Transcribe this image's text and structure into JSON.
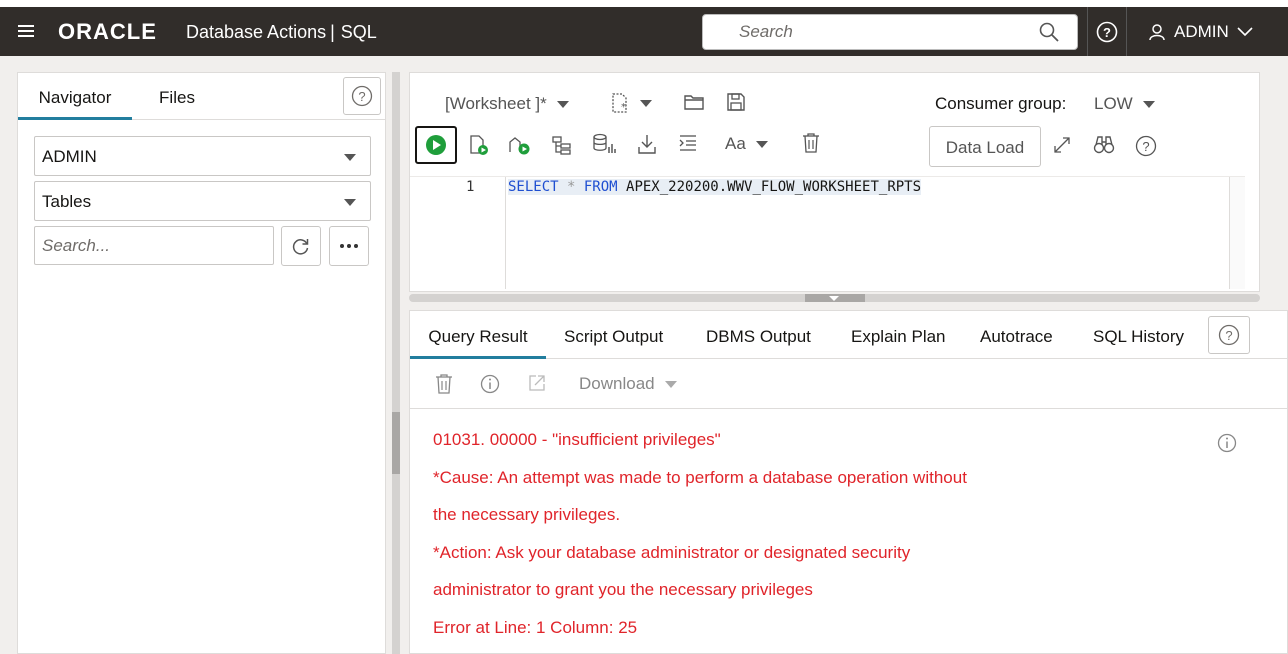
{
  "header": {
    "logo": "ORACLE",
    "app_name": "Database Actions",
    "separator": "|",
    "page_name": "SQL",
    "search_placeholder": "Search",
    "user": "ADMIN"
  },
  "navigator": {
    "tabs": [
      "Navigator",
      "Files"
    ],
    "schema": "ADMIN",
    "object_type": "Tables",
    "search_placeholder": "Search..."
  },
  "worksheet": {
    "name": "[Worksheet ]*",
    "consumer_group_label": "Consumer group:",
    "consumer_group_value": "LOW",
    "data_load_label": "Data Load",
    "font_label": "Aa"
  },
  "editor": {
    "line_number": "1",
    "code": {
      "kw1": "SELECT",
      "star": " * ",
      "kw2": "FROM",
      "rest": " APEX_220200.WWV_FLOW_WORKSHEET_RPTS"
    }
  },
  "results": {
    "tabs": [
      "Query Result",
      "Script Output",
      "DBMS Output",
      "Explain Plan",
      "Autotrace",
      "SQL History"
    ],
    "download_label": "Download",
    "messages": [
      "01031. 00000 -  \"insufficient privileges\"",
      "*Cause:    An attempt was made to perform a database operation without",
      "the necessary privileges.",
      "*Action:   Ask your database administrator or designated security",
      "administrator to grant you the necessary privileges",
      "Error at Line: 1 Column: 25"
    ]
  },
  "colors": {
    "header_bg": "#312d2a",
    "active_tab": "#227e9e",
    "error_text": "#e0242a",
    "run_green": "#1f9e3b",
    "keyword_blue": "#1f4fd1"
  }
}
